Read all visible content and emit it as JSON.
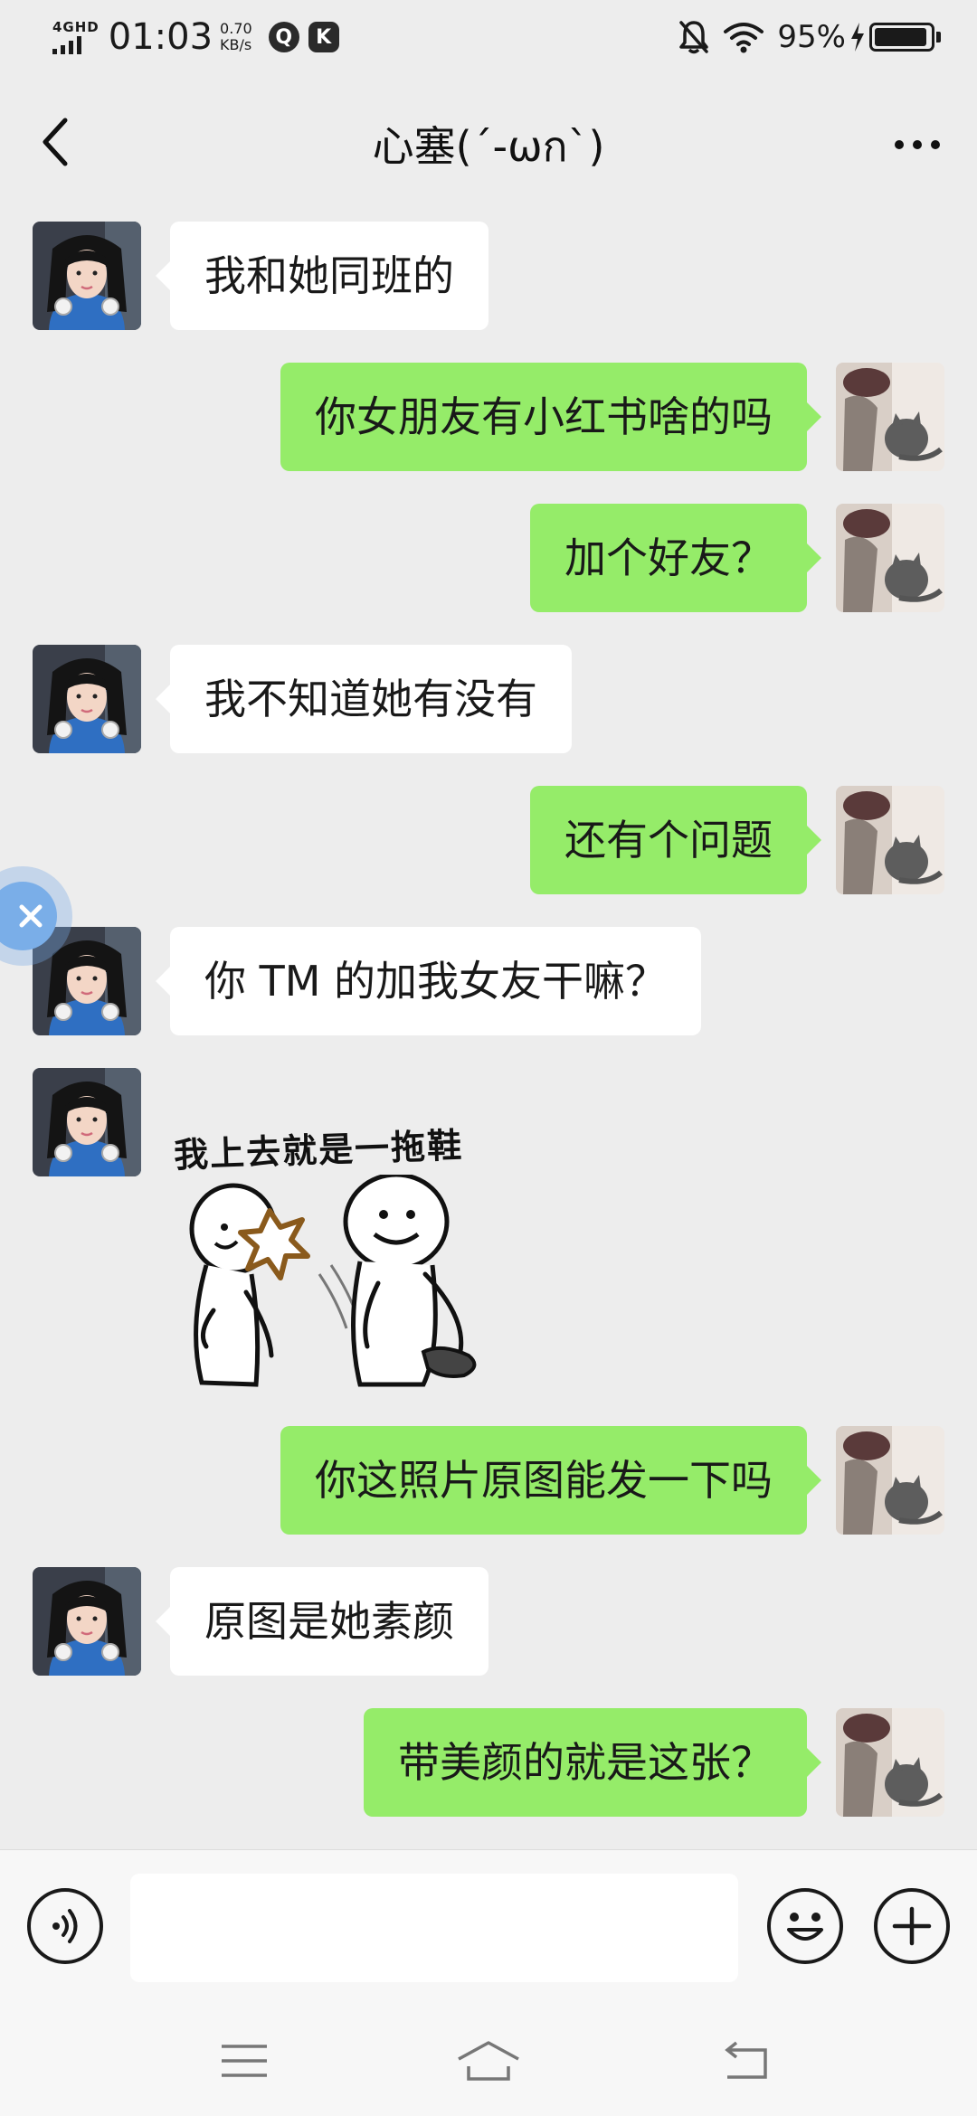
{
  "status_bar": {
    "network_type": "4GHD",
    "time": "01:03",
    "net_speed_value": "0.70",
    "net_speed_unit": "KB/s",
    "app_icon_1": "Q",
    "app_icon_2": "K",
    "battery_percent": "95%",
    "battery_level": 0.95,
    "icons": [
      "signal-icon",
      "mute-bell-icon",
      "wifi-icon",
      "charging-icon",
      "battery-icon"
    ]
  },
  "header": {
    "title": "心塞(´-ωก`)",
    "back_icon": "chevron-left-icon",
    "more_icon": "more-dots-icon"
  },
  "messages": [
    {
      "side": "left",
      "type": "text",
      "text": "我和她同班的"
    },
    {
      "side": "right",
      "type": "text",
      "text": "你女朋友有小红书啥的吗"
    },
    {
      "side": "right",
      "type": "text",
      "text": "加个好友？"
    },
    {
      "side": "left",
      "type": "text",
      "text": "我不知道她有没有"
    },
    {
      "side": "right",
      "type": "text",
      "text": "还有个问题"
    },
    {
      "side": "left",
      "type": "text",
      "text": "你 TM 的加我女友干嘛？"
    },
    {
      "side": "left",
      "type": "sticker",
      "text": "我上去就是一拖鞋"
    },
    {
      "side": "right",
      "type": "text",
      "text": "你这照片原图能发一下吗"
    },
    {
      "side": "left",
      "type": "text",
      "text": "原图是她素颜"
    },
    {
      "side": "right",
      "type": "text",
      "text": "带美颜的就是这张？"
    }
  ],
  "input_bar": {
    "value": "",
    "voice_icon": "voice-icon",
    "emoji_icon": "emoji-icon",
    "plus_icon": "plus-circle-icon"
  },
  "nav_bar": {
    "icons": [
      "menu-icon",
      "home-icon",
      "back-nav-icon"
    ]
  },
  "colors": {
    "background": "#ededed",
    "sent_bubble": "#95ec69",
    "received_bubble": "#ffffff"
  }
}
